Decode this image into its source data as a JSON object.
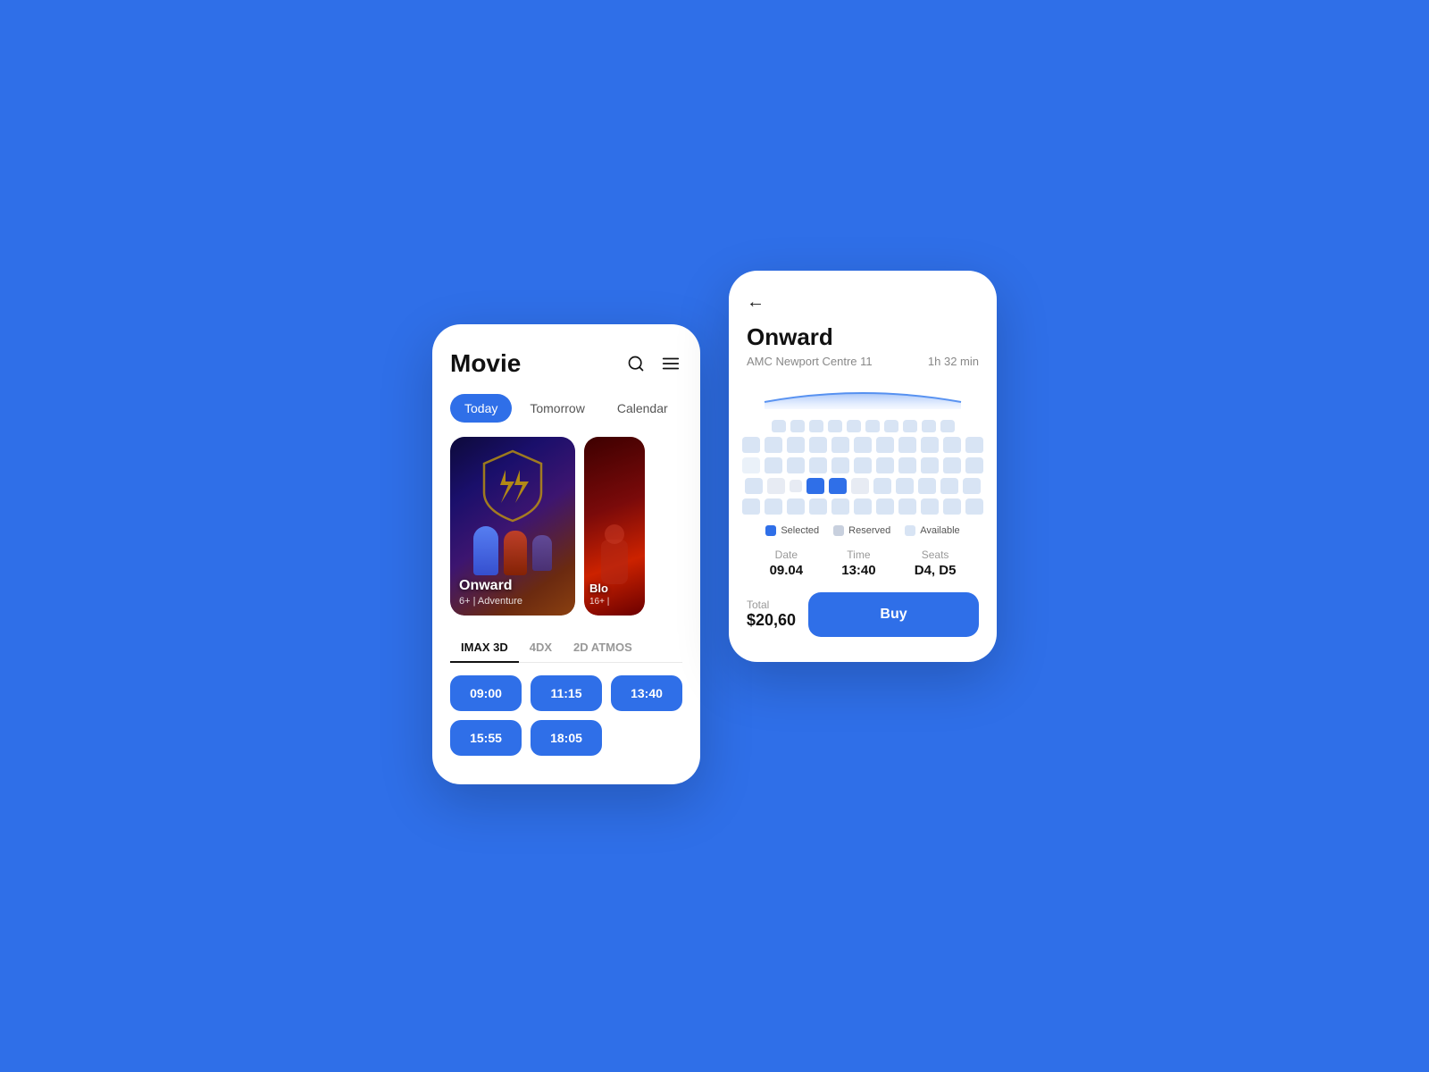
{
  "background": "#2F6FE8",
  "leftPhone": {
    "title": "Movie",
    "tabs": [
      {
        "label": "Today",
        "active": true
      },
      {
        "label": "Tomorrow",
        "active": false
      },
      {
        "label": "Calendar",
        "active": false
      }
    ],
    "movies": [
      {
        "title": "Onward",
        "meta": "6+ | Adventure",
        "id": "onward"
      },
      {
        "title": "Blo",
        "meta": "16+ |",
        "id": "blood"
      }
    ],
    "formatTabs": [
      {
        "label": "IMAX 3D",
        "active": true
      },
      {
        "label": "4DX",
        "active": false
      },
      {
        "label": "2D ATMOS",
        "active": false
      }
    ],
    "showtimes": [
      "09:00",
      "11:15",
      "13:40",
      "15:55",
      "18:05"
    ]
  },
  "rightPhone": {
    "backLabel": "←",
    "movieTitle": "Onward",
    "venue": "AMC Newport Centre 11",
    "duration": "1h 32 min",
    "legend": {
      "selected": "Selected",
      "reserved": "Reserved",
      "available": "Available"
    },
    "bookingDetails": {
      "date": {
        "label": "Date",
        "value": "09.04"
      },
      "time": {
        "label": "Time",
        "value": "13:40"
      },
      "seats": {
        "label": "Seats",
        "value": "D4, D5"
      }
    },
    "total": {
      "label": "Total",
      "price": "$20,60"
    },
    "buyLabel": "Buy"
  }
}
